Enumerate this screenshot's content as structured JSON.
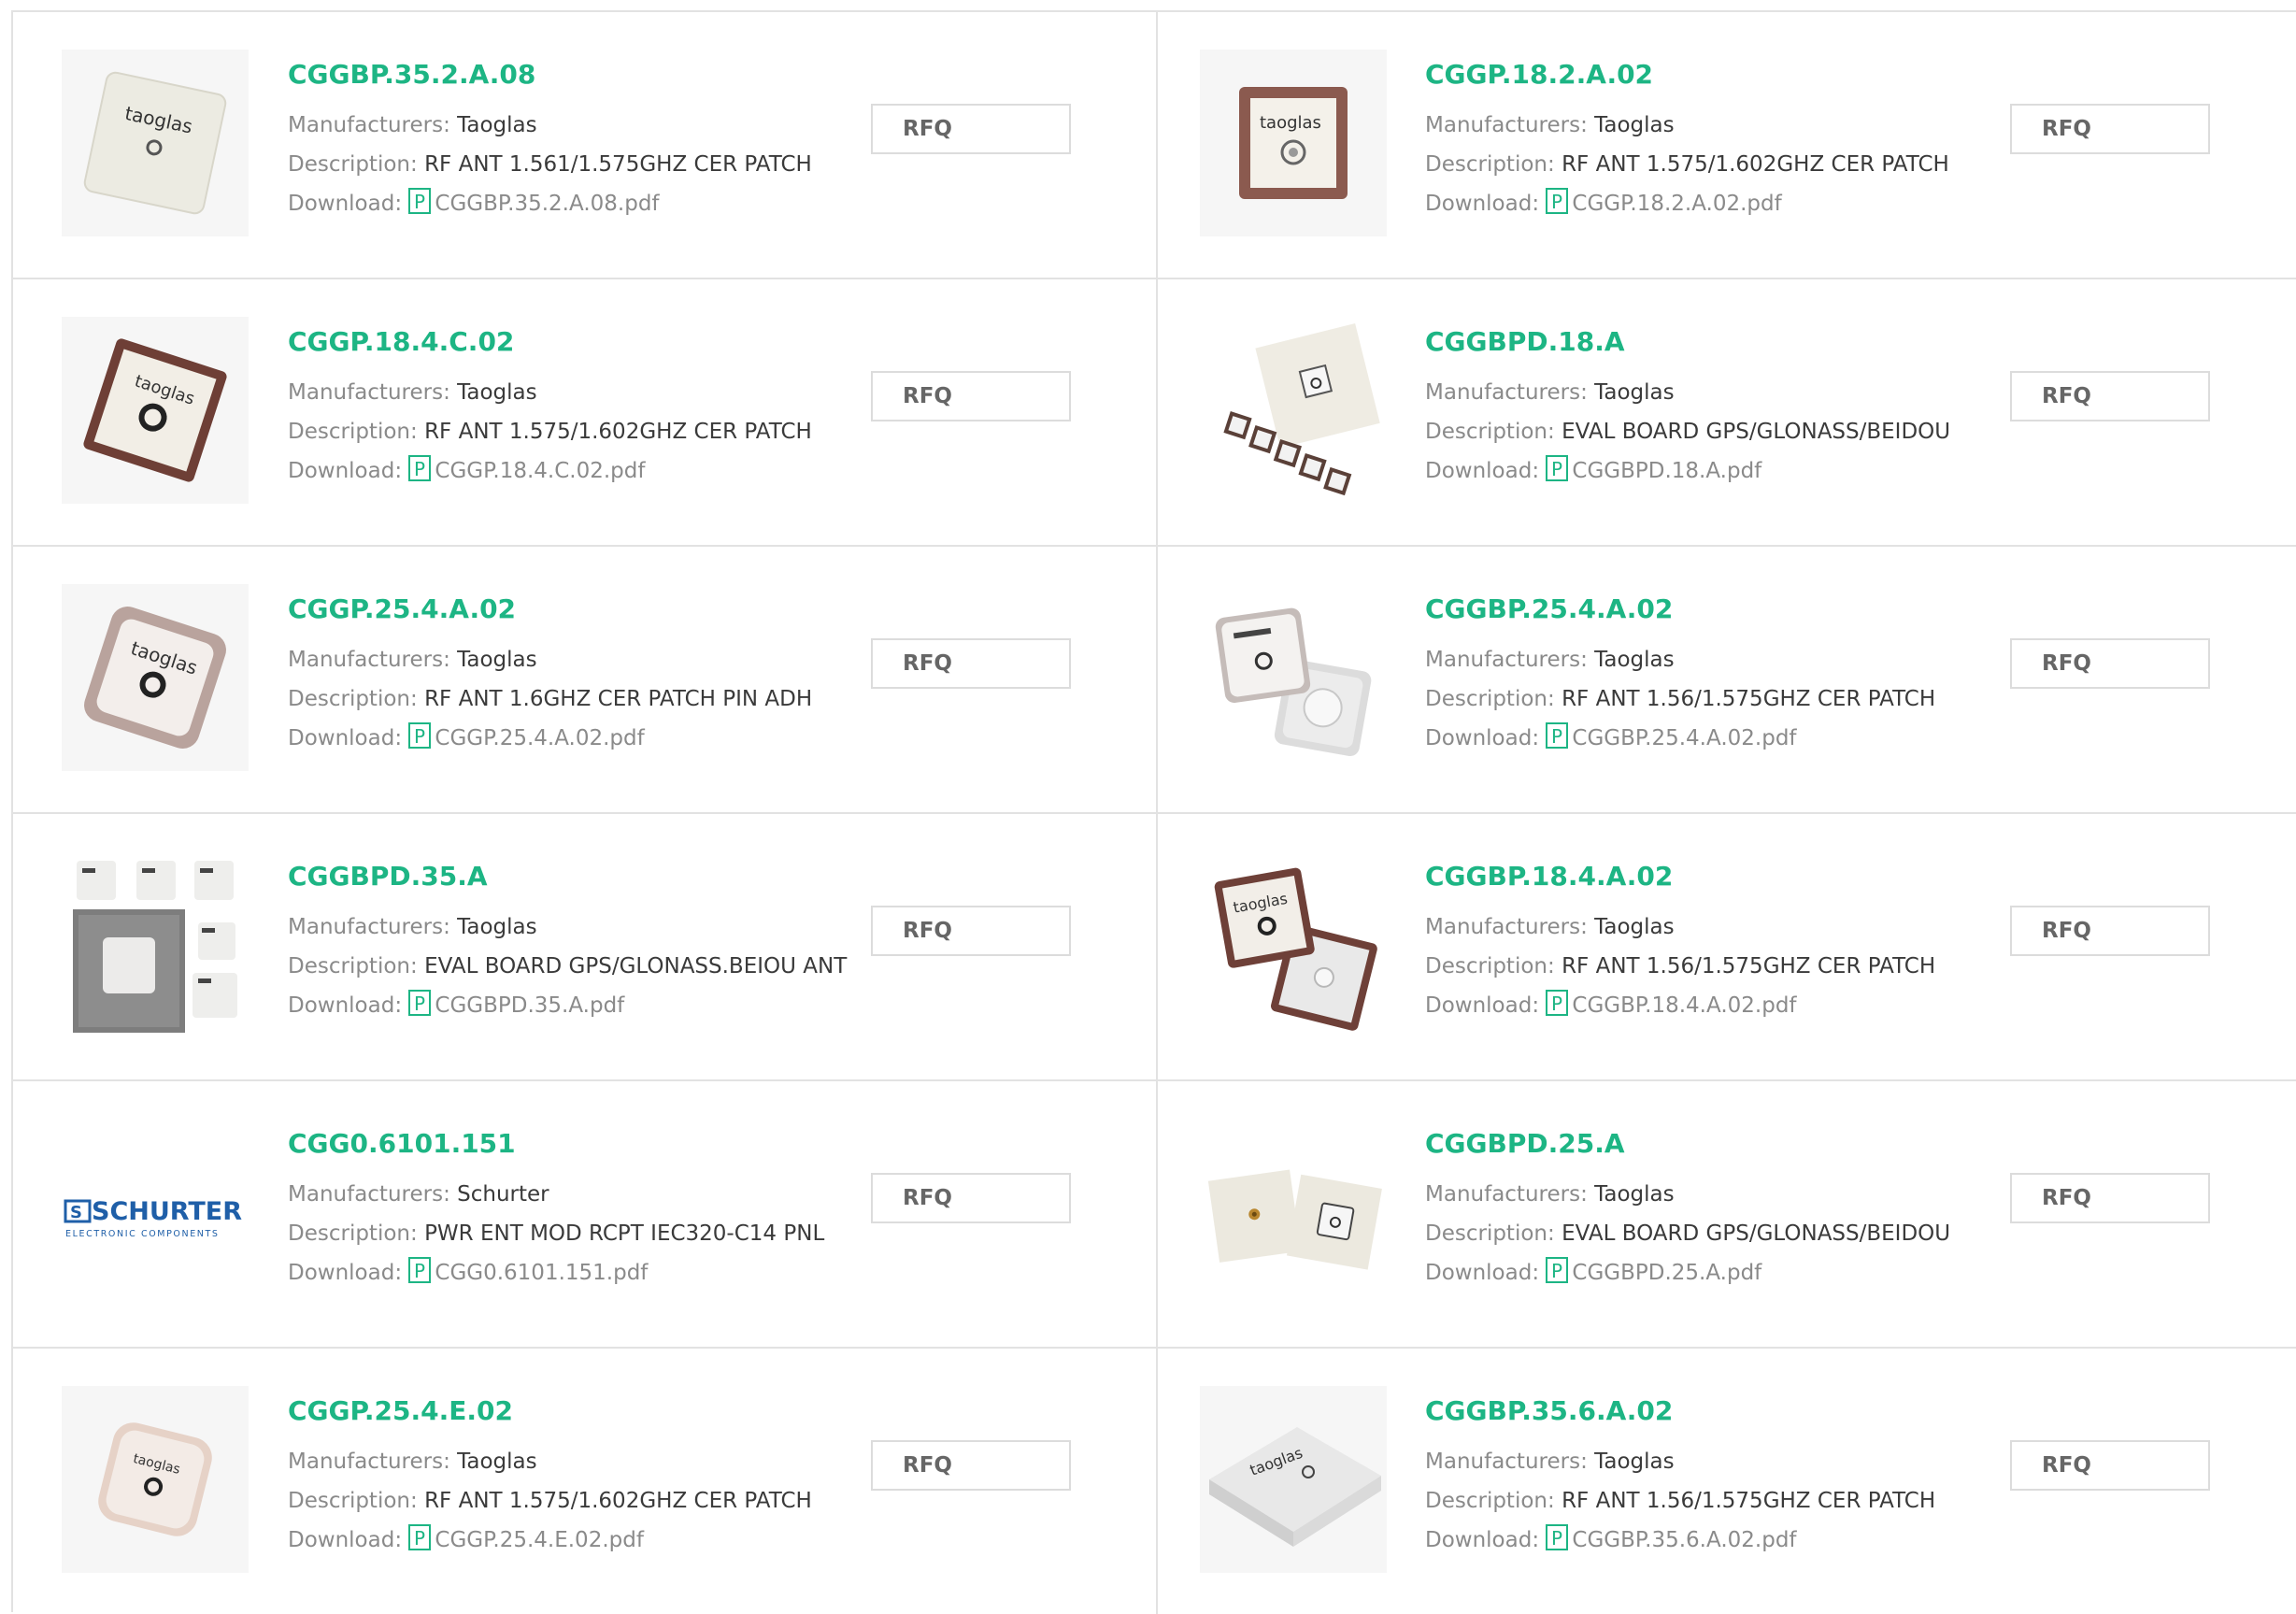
{
  "labels": {
    "manufacturers": "Manufacturers:",
    "description": "Description:",
    "download": "Download:",
    "rfq": "RFQ"
  },
  "products": [
    {
      "part": "CGGBP.35.2.A.08",
      "manufacturer": "Taoglas",
      "description": "RF ANT 1.561/1.575GHZ CER PATCH",
      "file": "CGGBP.35.2.A.08.pdf",
      "image": "white-square-patch-antenna",
      "image_text": "taoglas"
    },
    {
      "part": "CGGP.18.2.A.02",
      "manufacturer": "Taoglas",
      "description": "RF ANT 1.575/1.602GHZ CER PATCH",
      "file": "CGGP.18.2.A.02.pdf",
      "image": "brown-square-patch-antenna",
      "image_text": "taoglas"
    },
    {
      "part": "CGGP.18.4.C.02",
      "manufacturer": "Taoglas",
      "description": "RF ANT 1.575/1.602GHZ CER PATCH",
      "file": "CGGP.18.4.C.02.pdf",
      "image": "brown-tilted-patch-antenna",
      "image_text": "taoglas"
    },
    {
      "part": "CGGBPD.18.A",
      "manufacturer": "Taoglas",
      "description": "EVAL BOARD GPS/GLONASS/BEIDOU",
      "file": "CGGBPD.18.A.pdf",
      "image": "eval-board-small-patches",
      "image_text": ""
    },
    {
      "part": "CGGP.25.4.A.02",
      "manufacturer": "Taoglas",
      "description": "RF ANT 1.6GHZ CER PATCH PIN ADH",
      "file": "CGGP.25.4.A.02.pdf",
      "image": "mauve-tilted-patch-antenna",
      "image_text": "taoglas"
    },
    {
      "part": "CGGBP.25.4.A.02",
      "manufacturer": "Taoglas",
      "description": "RF ANT 1.56/1.575GHZ CER PATCH",
      "file": "CGGBP.25.4.A.02.pdf",
      "image": "white-patch-pair",
      "image_text": ""
    },
    {
      "part": "CGGBPD.35.A",
      "manufacturer": "Taoglas",
      "description": "EVAL BOARD GPS/GLONASS.BEIOU ANT",
      "file": "CGGBPD.35.A.pdf",
      "image": "eval-board-multiple-patches",
      "image_text": ""
    },
    {
      "part": "CGGBP.18.4.A.02",
      "manufacturer": "Taoglas",
      "description": "RF ANT 1.56/1.575GHZ CER PATCH",
      "file": "CGGBP.18.4.A.02.pdf",
      "image": "brown-white-patch-pair",
      "image_text": "taoglas"
    },
    {
      "part": "CGG0.6101.151",
      "manufacturer": "Schurter",
      "description": "PWR ENT MOD RCPT IEC320-C14 PNL",
      "file": "CGG0.6101.151.pdf",
      "image": "schurter-logo",
      "image_text": "SCHURTER",
      "image_subtext": "ELECTRONIC COMPONENTS"
    },
    {
      "part": "CGGBPD.25.A",
      "manufacturer": "Taoglas",
      "description": "EVAL BOARD GPS/GLONASS/BEIDOU",
      "file": "CGGBPD.25.A.pdf",
      "image": "eval-board-pair",
      "image_text": ""
    },
    {
      "part": "CGGP.25.4.E.02",
      "manufacturer": "Taoglas",
      "description": "RF ANT 1.575/1.602GHZ CER PATCH",
      "file": "CGGP.25.4.E.02.pdf",
      "image": "beige-patch-antenna",
      "image_text": "taoglas"
    },
    {
      "part": "CGGBP.35.6.A.02",
      "manufacturer": "Taoglas",
      "description": "RF ANT 1.56/1.575GHZ CER PATCH",
      "file": "CGGBP.35.6.A.02.pdf",
      "image": "white-flat-patch-antenna",
      "image_text": "taoglas"
    }
  ],
  "colors": {
    "title": "#1db584",
    "label": "#8a8a8a",
    "value": "#3a3a3a",
    "pdf_icon": "#1db584",
    "border": "#e2e2e2",
    "schurter_blue": "#1f5fa8"
  }
}
